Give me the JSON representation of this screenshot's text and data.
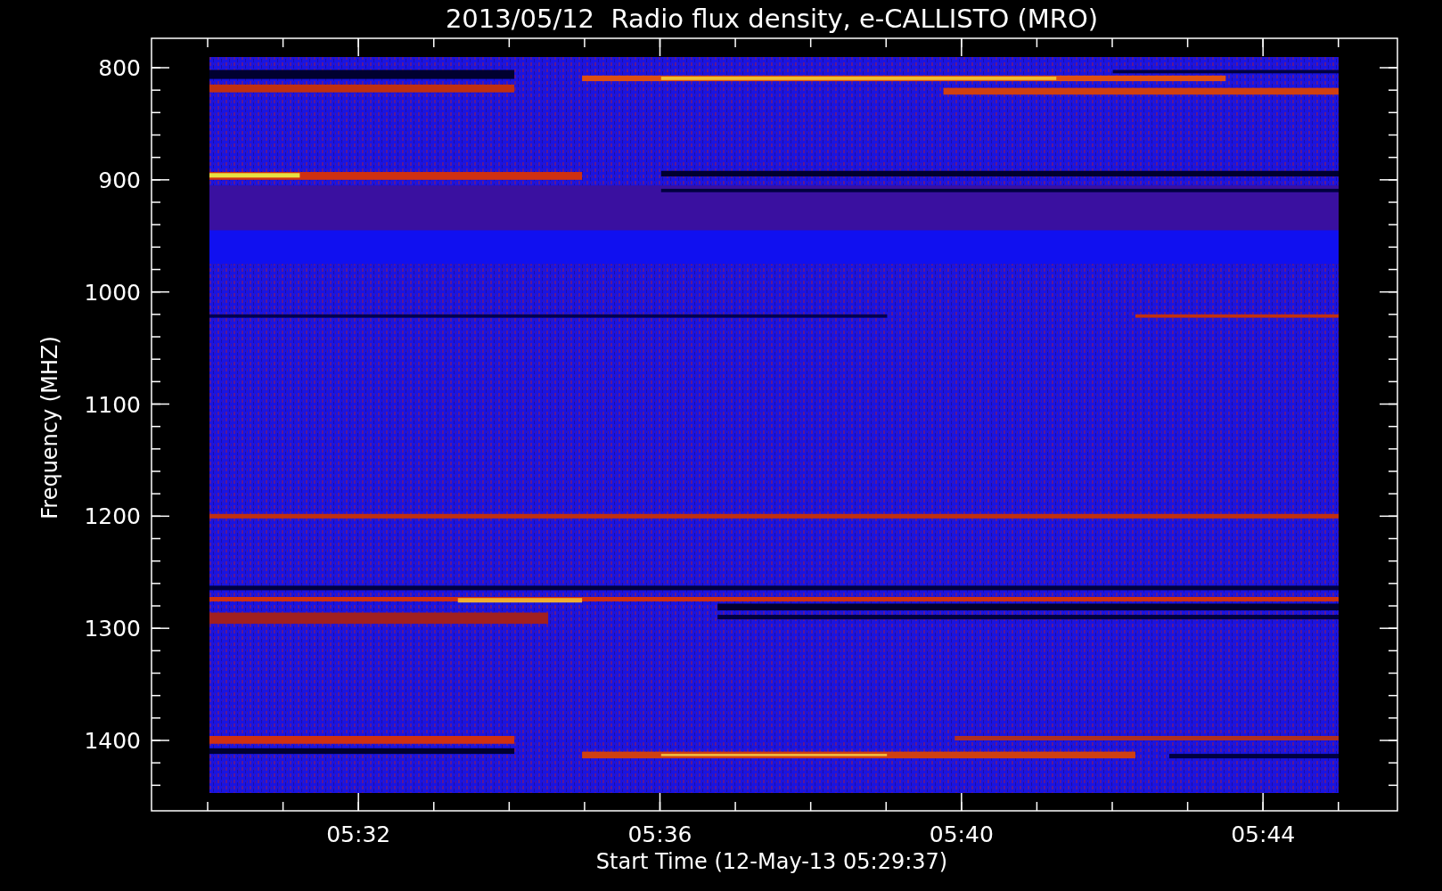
{
  "title": "2013/05/12  Radio flux density, e-CALLISTO (MRO)",
  "y_axis": {
    "label": "Frequency (MHZ)",
    "ticks": [
      "800",
      "900",
      "1000",
      "1100",
      "1200",
      "1300",
      "1400"
    ]
  },
  "x_axis": {
    "label": "Start Time (12-May-13 05:29:37)",
    "ticks": [
      "05:32",
      "05:36",
      "05:40",
      "05:44"
    ]
  }
}
